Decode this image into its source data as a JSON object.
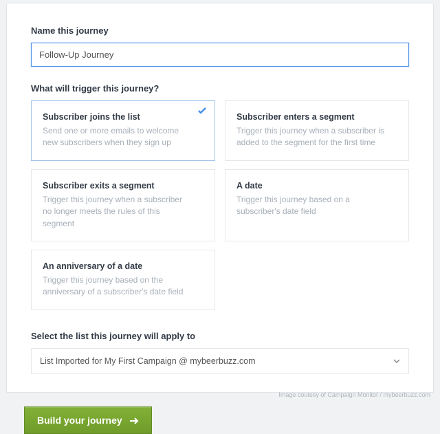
{
  "name_section": {
    "label": "Name this journey",
    "value": "Follow-Up Journey"
  },
  "trigger_section": {
    "label": "What will trigger this journey?",
    "options": [
      {
        "title": "Subscriber joins the list",
        "desc": "Send one or more emails to welcome new subscribers when they sign up",
        "selected": true
      },
      {
        "title": "Subscriber enters a segment",
        "desc": "Trigger this journey when a subscriber is added to the segment for the first time",
        "selected": false
      },
      {
        "title": "Subscriber exits a segment",
        "desc": "Trigger this journey when a subscriber no longer meets the rules of this segment",
        "selected": false
      },
      {
        "title": "A date",
        "desc": "Trigger this journey based on a subscriber's date field",
        "selected": false
      },
      {
        "title": "An anniversary of a date",
        "desc": "Trigger this journey based on the anniversary of a subscriber's date field",
        "selected": false
      }
    ]
  },
  "list_section": {
    "label": "Select the list this journey will apply to",
    "selected": "List Imported for My First Campaign @ mybeerbuzz.com"
  },
  "footer": {
    "build_label": "Build your journey",
    "credit": "Image coutesy of Campaign Monitor / mybeerbuzz.com"
  }
}
